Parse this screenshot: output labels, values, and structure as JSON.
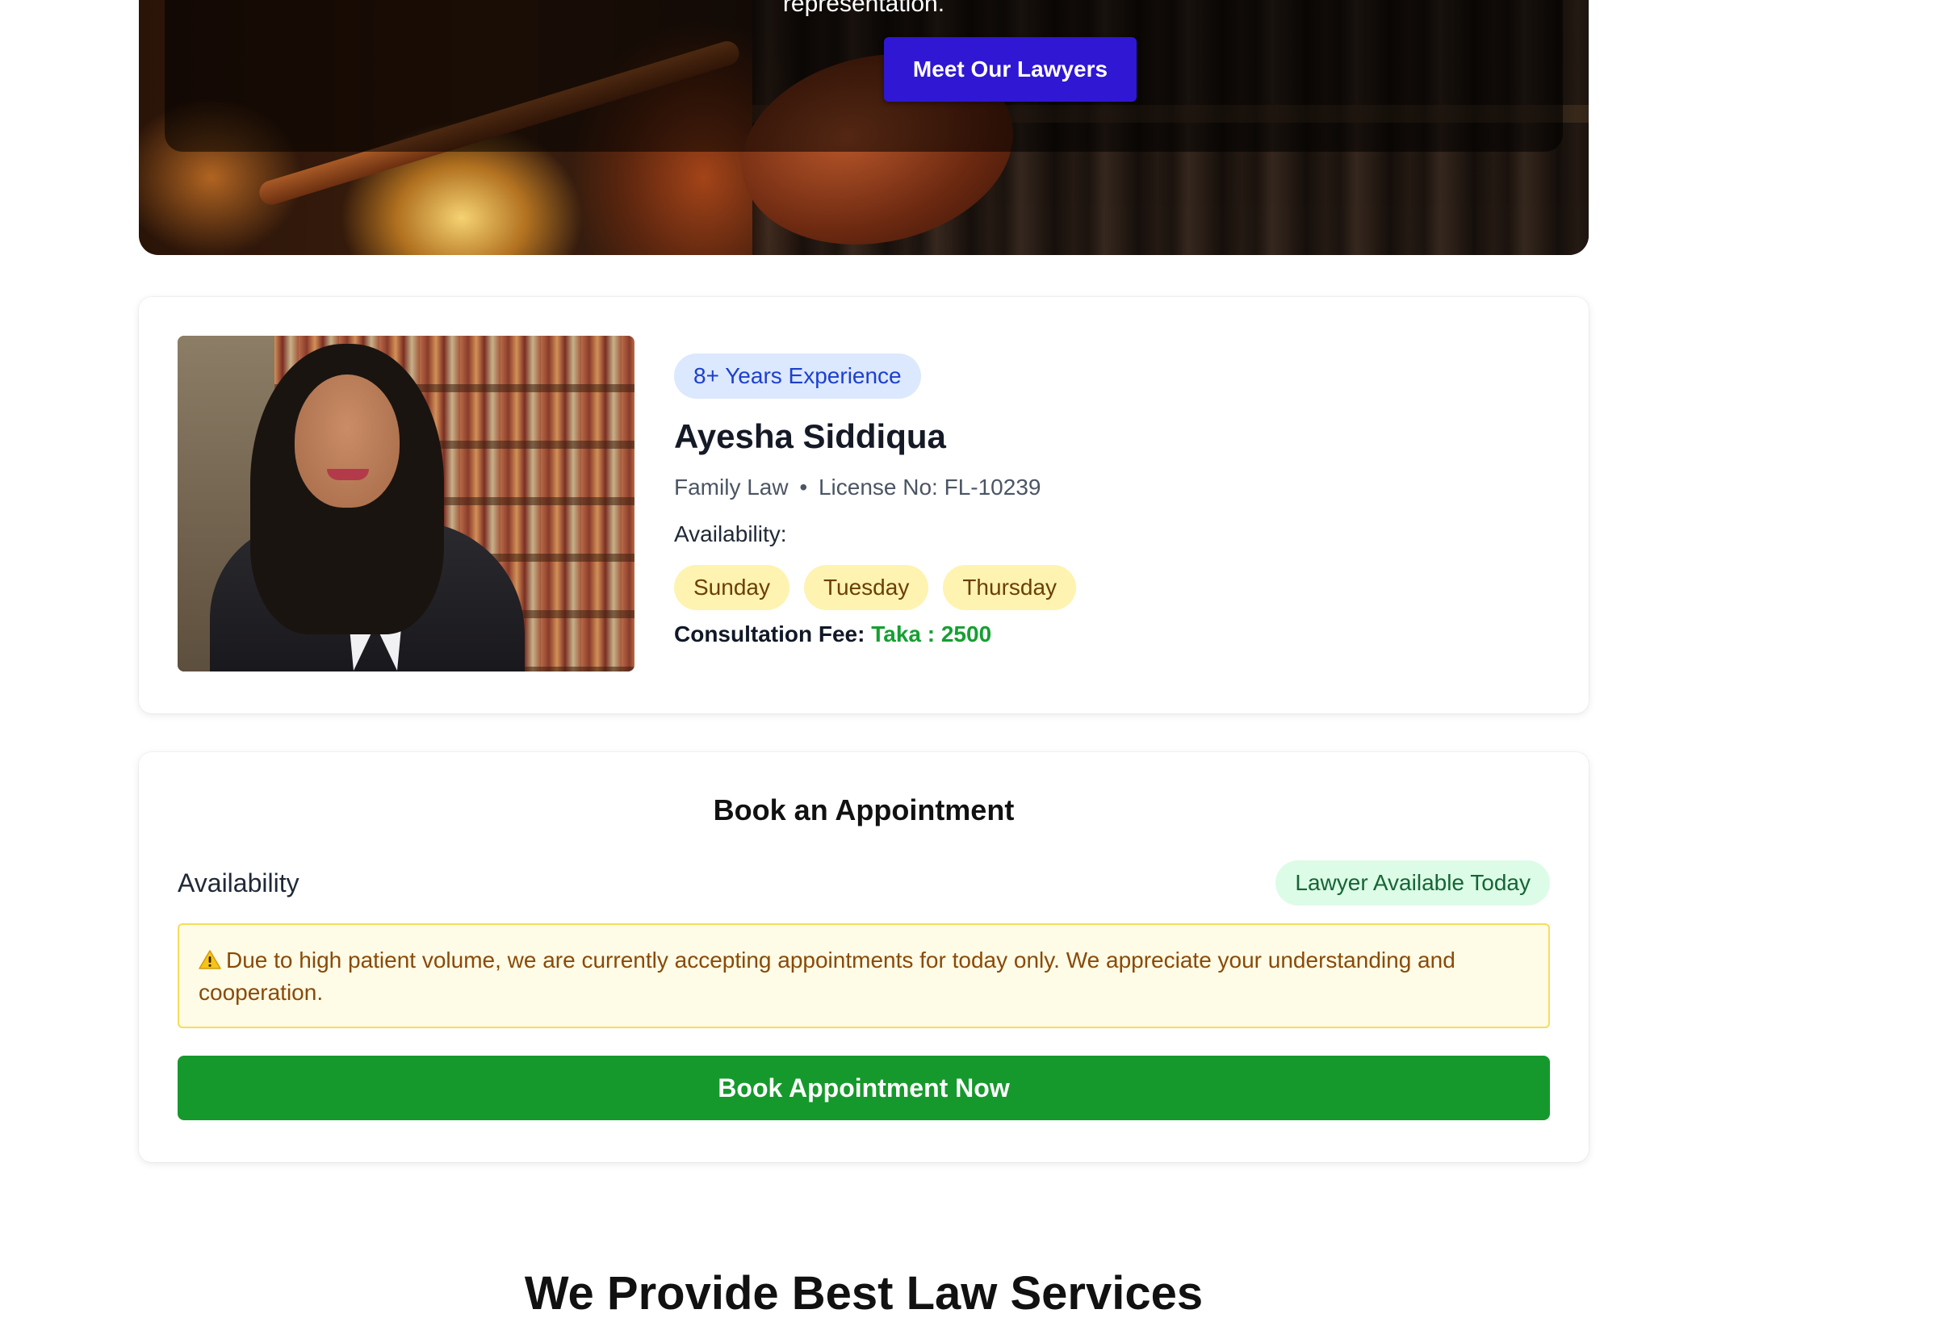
{
  "hero": {
    "tagline": "representation.",
    "cta_label": "Meet Our Lawyers"
  },
  "lawyer": {
    "experience_badge": "8+ Years Experience",
    "name": "Ayesha Siddiqua",
    "practice_area": "Family Law",
    "separator": "•",
    "license": "License No: FL-10239",
    "availability_label": "Availability:",
    "available_days": [
      "Sunday",
      "Tuesday",
      "Thursday"
    ],
    "fee_label": "Consultation Fee:",
    "fee_value": "Taka : 2500"
  },
  "appointment": {
    "title": "Book an Appointment",
    "availability_label": "Availability",
    "status_badge": "Lawyer Available Today",
    "notice": "Due to high patient volume, we are currently accepting appointments for today only. We appreciate your understanding and cooperation.",
    "button_label": "Book Appointment Now"
  },
  "services": {
    "heading": "We Provide Best Law Services"
  },
  "colors": {
    "primary_button": "#2f17d4",
    "success_button": "#16992c",
    "fee_green": "#15a032",
    "experience_badge_bg": "#dbe8fe",
    "day_pill_bg": "#fef3b0",
    "available_badge_bg": "#dcfce7",
    "notice_bg": "#fefbe6"
  },
  "icons": {
    "notice": "warning-icon"
  }
}
